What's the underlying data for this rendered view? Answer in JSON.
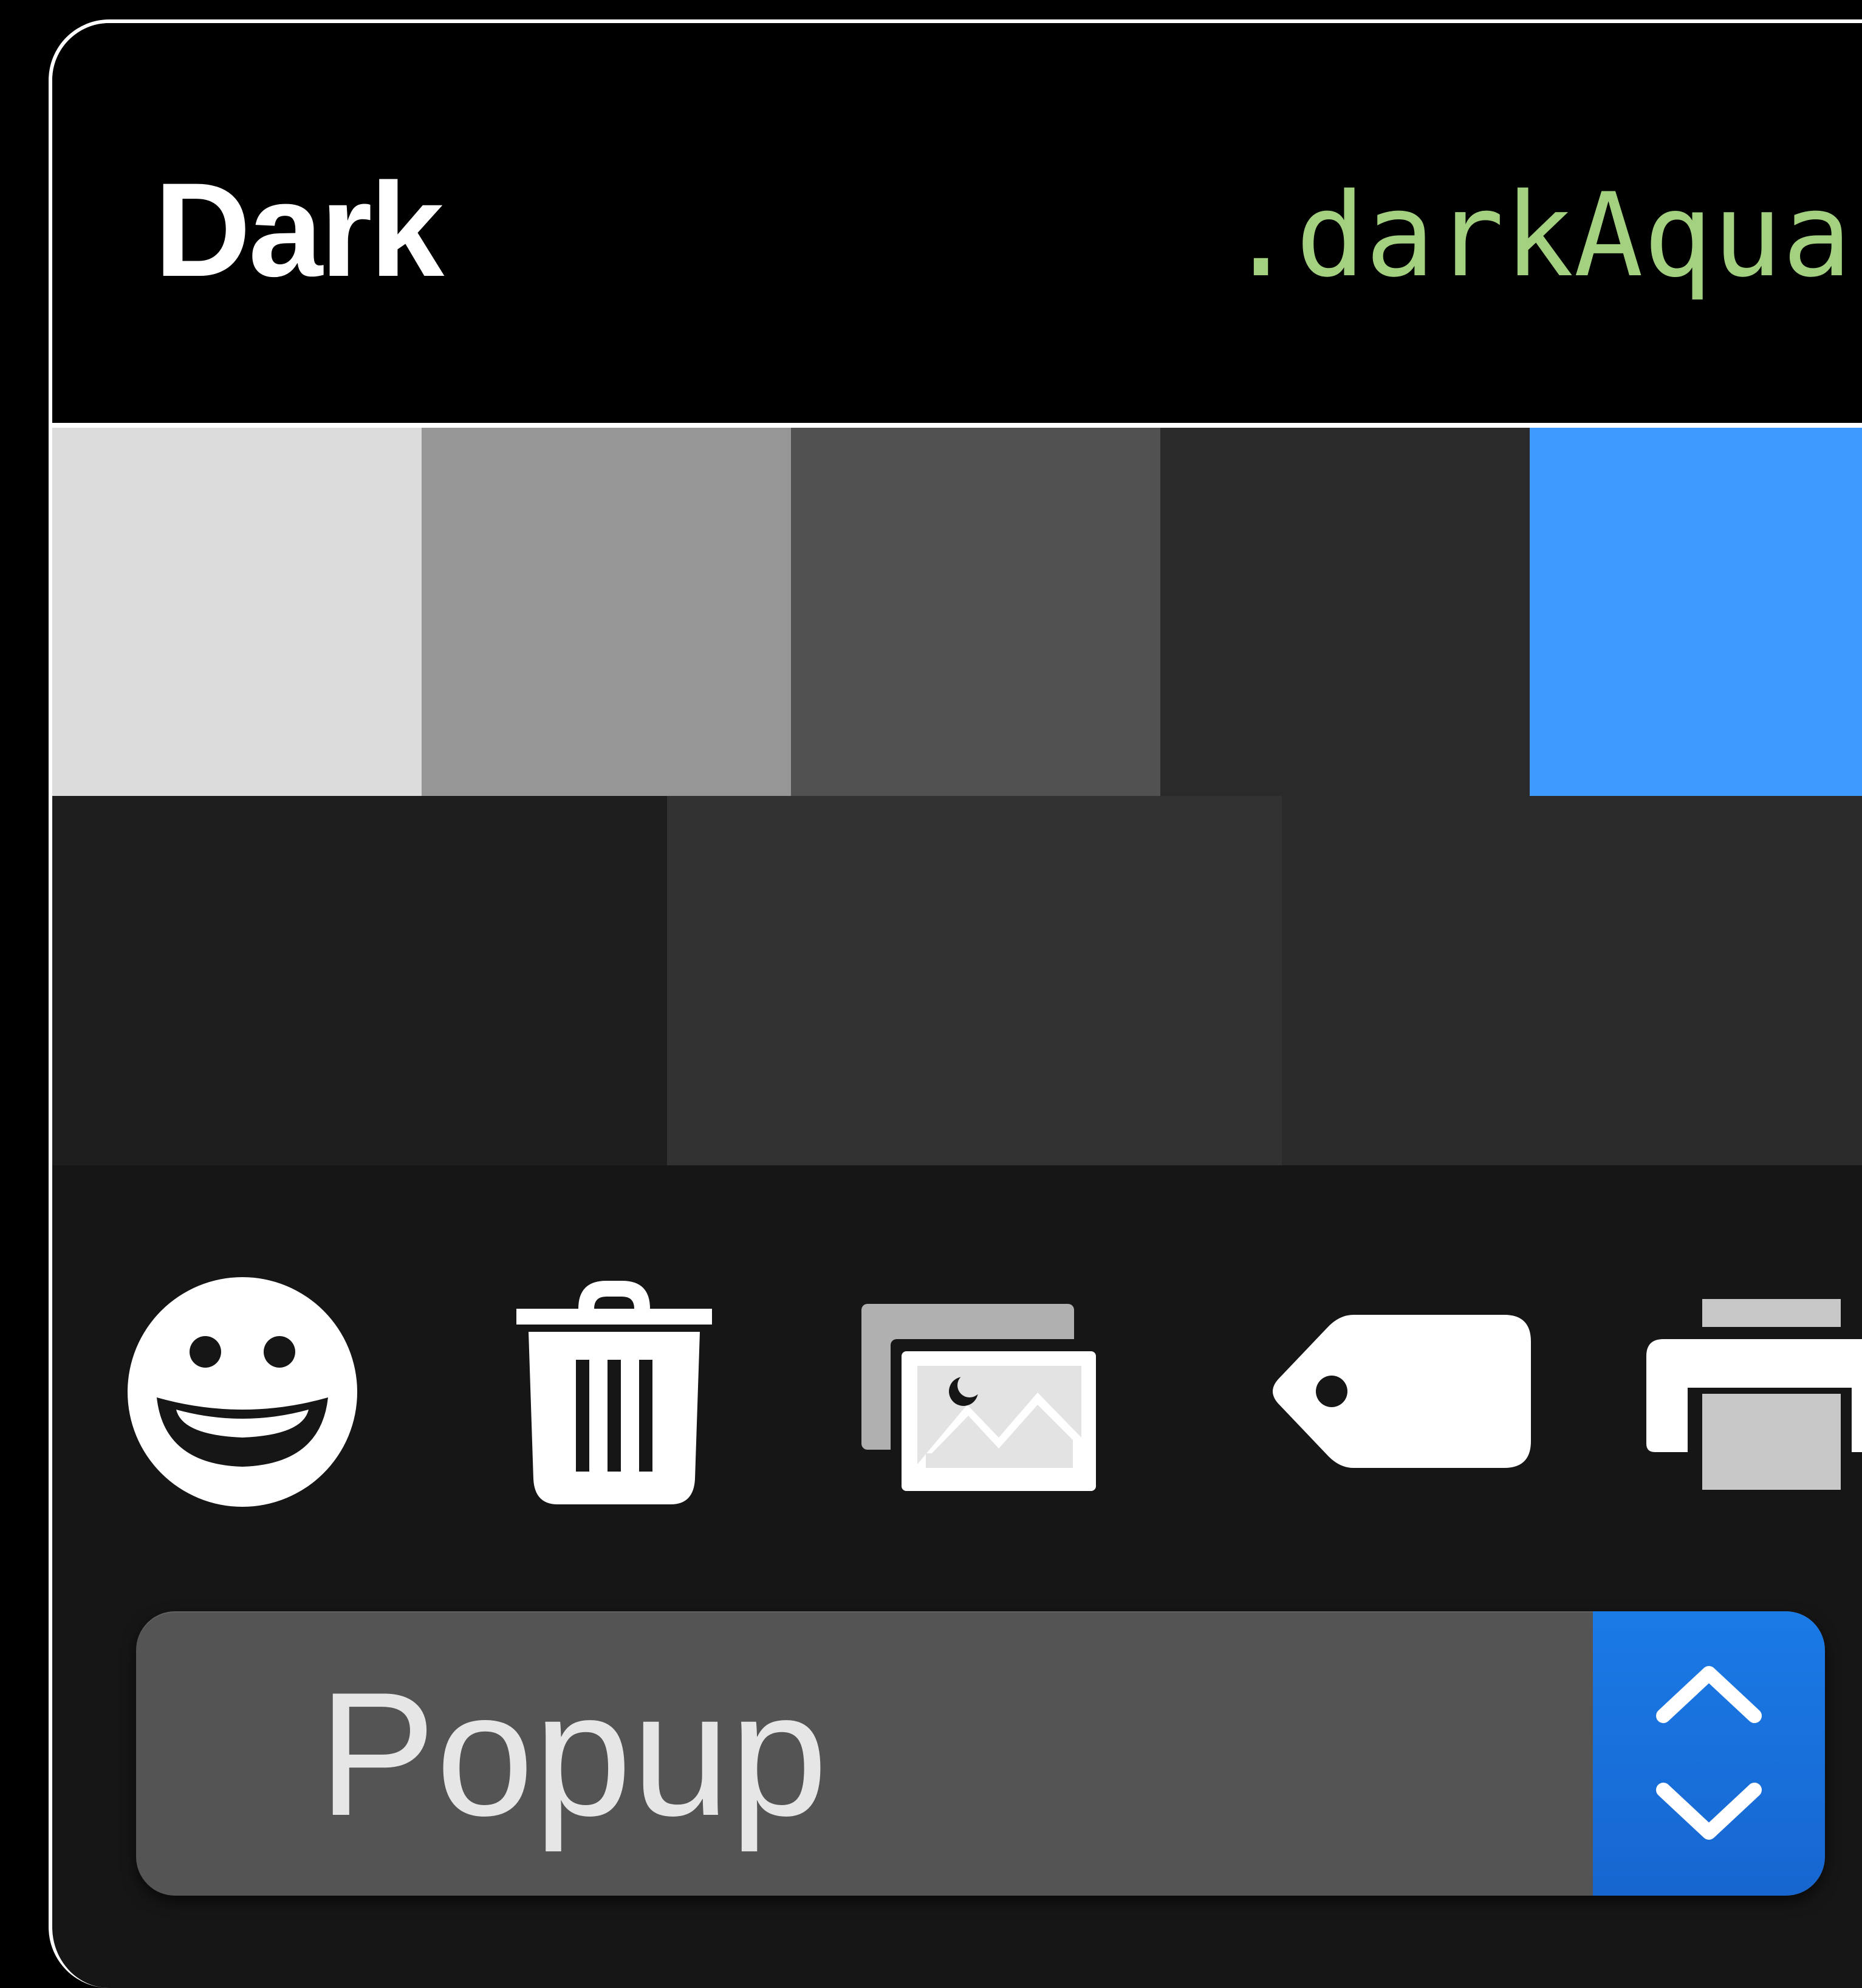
{
  "header": {
    "title": "Dark",
    "appearance_name": ".darkAqua"
  },
  "colors": {
    "background": "#161616",
    "header_background": "#000000",
    "title_color": "#ffffff",
    "appearance_name_color": "#a3d17f",
    "accent": "#3f9aff"
  },
  "swatches": {
    "row1": [
      "#dcdcdc",
      "#969696",
      "#515151",
      "#2a2a2a",
      "#3f9aff"
    ],
    "row2": [
      "#1e1e1e",
      "#323232",
      "#2a2a2a"
    ]
  },
  "icons": [
    {
      "name": "smiley-face-icon"
    },
    {
      "name": "trash-icon"
    },
    {
      "name": "photo-library-icon"
    },
    {
      "name": "tag-icon"
    },
    {
      "name": "printer-icon"
    }
  ],
  "popup": {
    "label": "Popup",
    "stepper_icon": "chevron-up-down-icon"
  }
}
